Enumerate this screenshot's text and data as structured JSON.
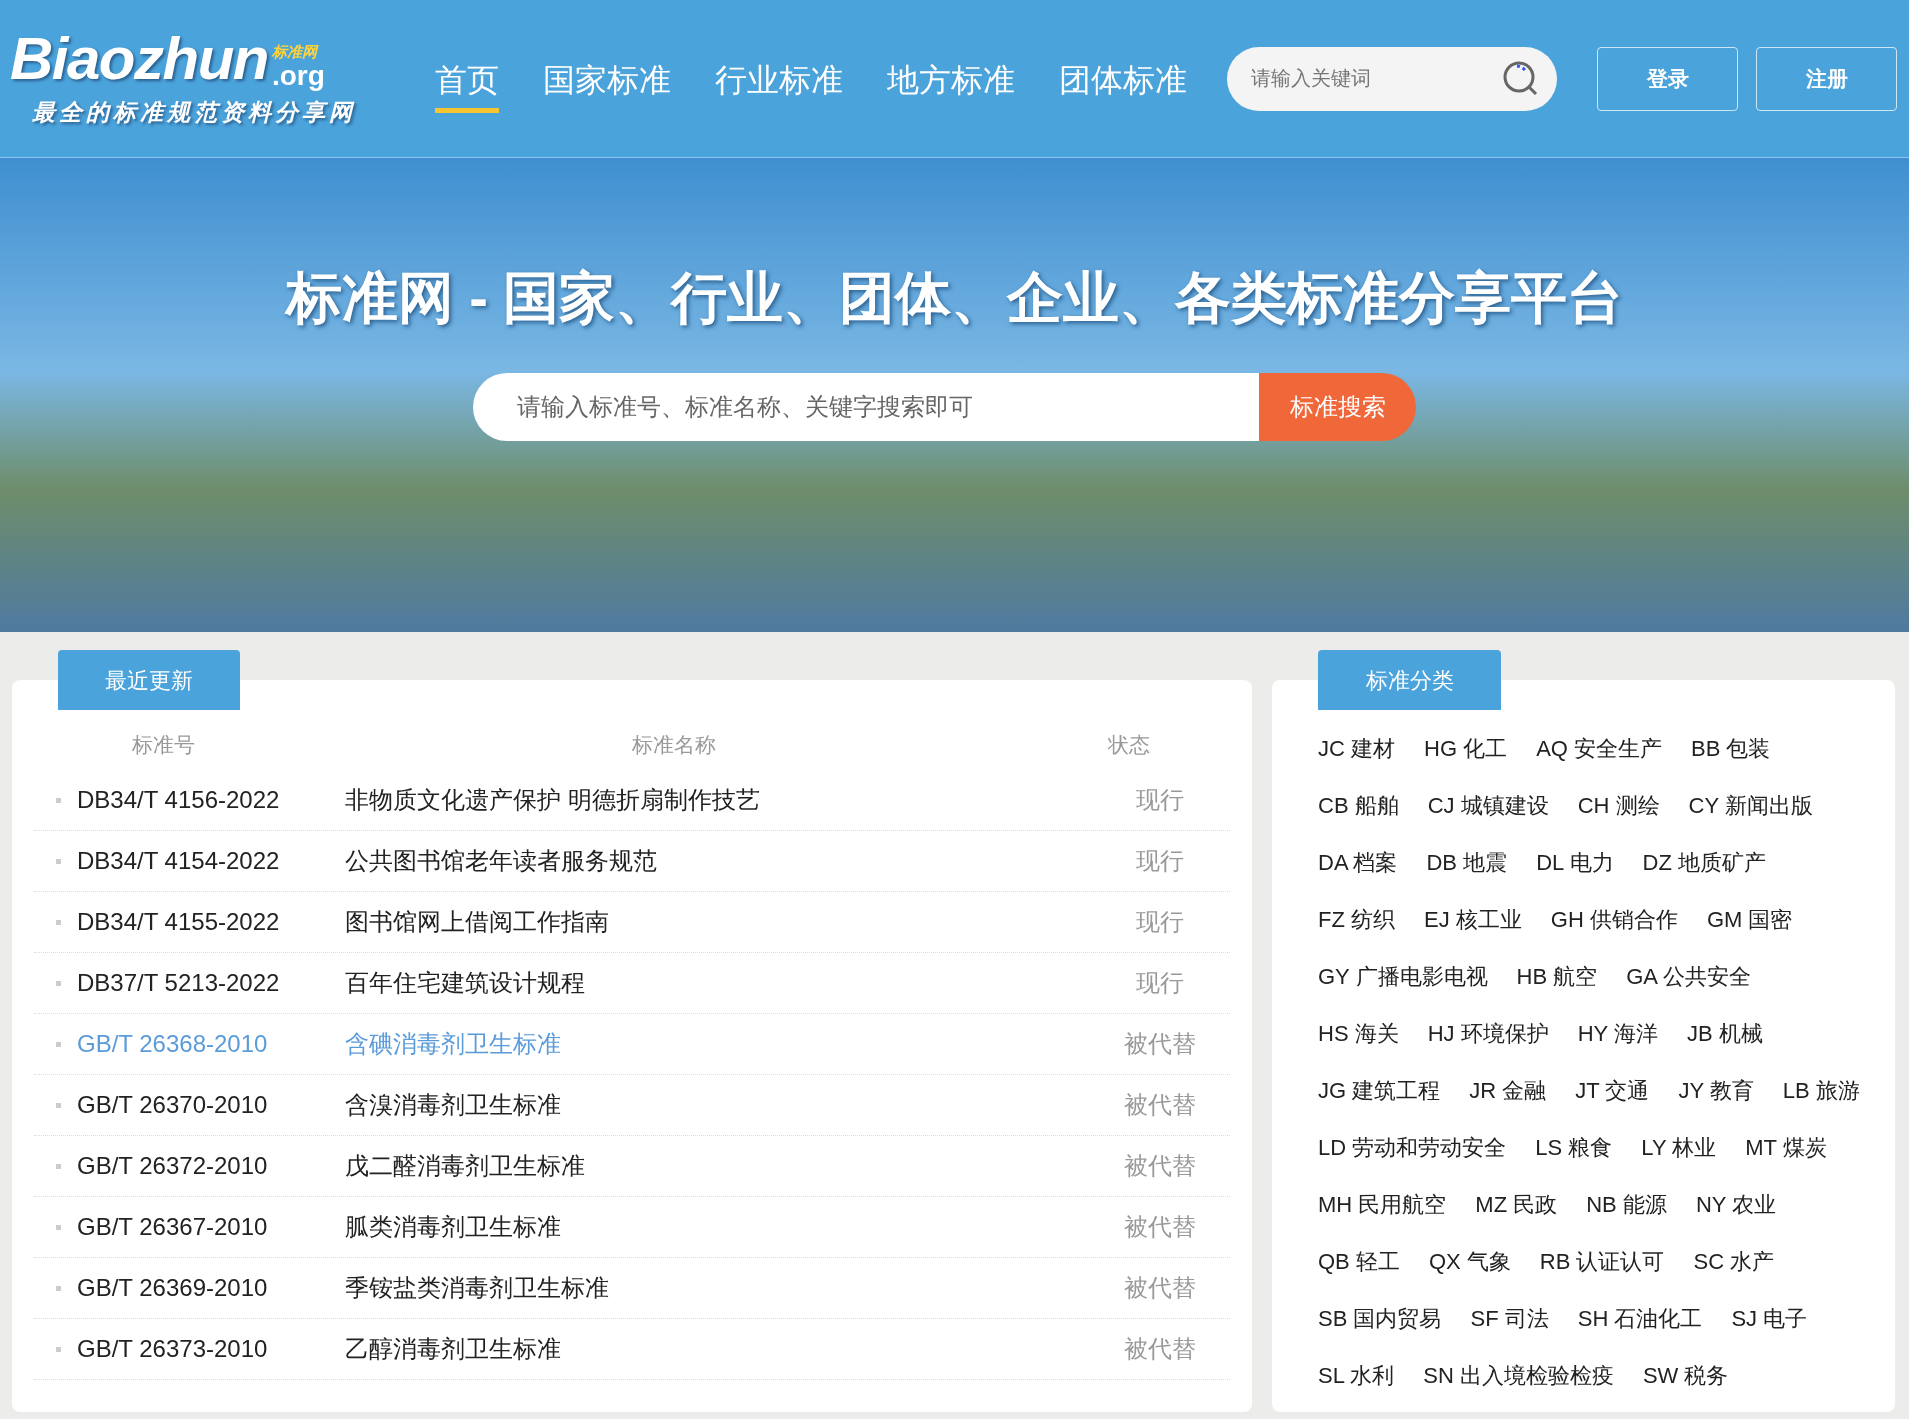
{
  "logo": {
    "wordmark": "Biaozhun",
    "domain": ".org",
    "badge": "标准网",
    "slogan": "最全的标准规范资料分享网"
  },
  "nav": [
    {
      "label": "首页",
      "selected": true
    },
    {
      "label": "国家标准",
      "selected": false
    },
    {
      "label": "行业标准",
      "selected": false
    },
    {
      "label": "地方标准",
      "selected": false
    },
    {
      "label": "团体标准",
      "selected": false
    }
  ],
  "header_search": {
    "placeholder": "请输入关键词"
  },
  "auth_buttons": [
    "登录",
    "注册"
  ],
  "hero": {
    "title": "标准网 - 国家、行业、团体、企业、各类标准分享平台",
    "search_placeholder": "请输入标准号、标准名称、关键字搜索即可",
    "search_button": "标准搜索"
  },
  "recent": {
    "tab": "最近更新",
    "columns": [
      "标准号",
      "标准名称",
      "状态"
    ],
    "rows": [
      {
        "code": "DB34/T 4156-2022",
        "name": "非物质文化遗产保护 明德折扇制作技艺",
        "status": "现行",
        "highlighted": false
      },
      {
        "code": "DB34/T 4154-2022",
        "name": "公共图书馆老年读者服务规范",
        "status": "现行",
        "highlighted": false
      },
      {
        "code": "DB34/T 4155-2022",
        "name": "图书馆网上借阅工作指南",
        "status": "现行",
        "highlighted": false
      },
      {
        "code": "DB37/T 5213-2022",
        "name": "百年住宅建筑设计规程",
        "status": "现行",
        "highlighted": false
      },
      {
        "code": "GB/T 26368-2010",
        "name": "含碘消毒剂卫生标准",
        "status": "被代替",
        "highlighted": true
      },
      {
        "code": "GB/T 26370-2010",
        "name": "含溴消毒剂卫生标准",
        "status": "被代替",
        "highlighted": false
      },
      {
        "code": "GB/T 26372-2010",
        "name": "戊二醛消毒剂卫生标准",
        "status": "被代替",
        "highlighted": false
      },
      {
        "code": "GB/T 26367-2010",
        "name": "胍类消毒剂卫生标准",
        "status": "被代替",
        "highlighted": false
      },
      {
        "code": "GB/T 26369-2010",
        "name": "季铵盐类消毒剂卫生标准",
        "status": "被代替",
        "highlighted": false
      },
      {
        "code": "GB/T 26373-2010",
        "name": "乙醇消毒剂卫生标准",
        "status": "被代替",
        "highlighted": false
      }
    ]
  },
  "categories": {
    "tab": "标准分类",
    "rows": [
      [
        "JC 建材",
        "HG 化工",
        "AQ 安全生产",
        "BB 包装"
      ],
      [
        "CB 船舶",
        "CJ 城镇建设",
        "CH 测绘",
        "CY 新闻出版"
      ],
      [
        "DA 档案",
        "DB 地震",
        "DL 电力",
        "DZ 地质矿产"
      ],
      [
        "FZ 纺织",
        "EJ 核工业",
        "GH 供销合作",
        "GM 国密"
      ],
      [
        "GY 广播电影电视",
        "HB 航空",
        "GA 公共安全"
      ],
      [
        "HS 海关",
        "HJ 环境保护",
        "HY 海洋",
        "JB 机械"
      ],
      [
        "JG 建筑工程",
        "JR 金融",
        "JT 交通",
        "JY 教育",
        "LB 旅游"
      ],
      [
        "LD 劳动和劳动安全",
        "LS 粮食",
        "LY 林业",
        "MT 煤炭"
      ],
      [
        "MH 民用航空",
        "MZ 民政",
        "NB 能源",
        "NY 农业"
      ],
      [
        "QB 轻工",
        "QX 气象",
        "RB 认证认可",
        "SC 水产"
      ],
      [
        "SB 国内贸易",
        "SF 司法",
        "SH 石油化工",
        "SJ 电子"
      ],
      [
        "SL 水利",
        "SN 出入境检验检疫",
        "SW 税务"
      ]
    ]
  }
}
